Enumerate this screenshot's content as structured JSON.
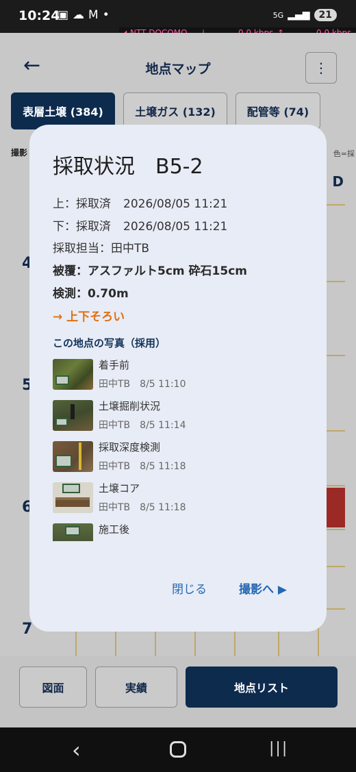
{
  "status_bar": {
    "time": "10:24",
    "network_type": "5G",
    "battery": "21",
    "carrier": "NTT DOCOMO",
    "down_speed": "0.0 kbps",
    "up_speed": "0.0 kbps"
  },
  "header": {
    "title": "地点マップ"
  },
  "tabs": [
    {
      "label": "表層土壌 (384)"
    },
    {
      "label": "土壌ガス (132)"
    },
    {
      "label": "配管等 (74)"
    }
  ],
  "background": {
    "side_label": "撮影",
    "side_right": "色=採",
    "column_label": "D",
    "row_labels": [
      "4",
      "5",
      "6",
      "7"
    ]
  },
  "bottom_nav": {
    "drawing_label": "図面",
    "results_label": "実績",
    "list_label": "地点リスト"
  },
  "dialog": {
    "title": "採取状況",
    "point_code": "B5-2",
    "upper": {
      "label": "上：採取済",
      "datetime": "2026/08/05 11:21"
    },
    "lower": {
      "label": "下：採取済",
      "datetime": "2026/08/05 11:21"
    },
    "person": "採取担当：田中TB",
    "cover": "被覆：アスファルト5cm 砕石15cm",
    "depth": "検測：0.70m",
    "aligned_note": "→ 上下そろい",
    "photos_heading": "この地点の写真（採用）",
    "photos": [
      {
        "name": "着手前",
        "author": "田中TB",
        "time": "8/5 11:10"
      },
      {
        "name": "土壌掘削状況",
        "author": "田中TB",
        "time": "8/5 11:14"
      },
      {
        "name": "採取深度検測",
        "author": "田中TB",
        "time": "8/5 11:18"
      },
      {
        "name": "土壌コア",
        "author": "田中TB",
        "time": "8/5 11:18"
      },
      {
        "name": "施工後"
      }
    ],
    "close_label": "閉じる",
    "shoot_label": "撮影へ ▶"
  }
}
